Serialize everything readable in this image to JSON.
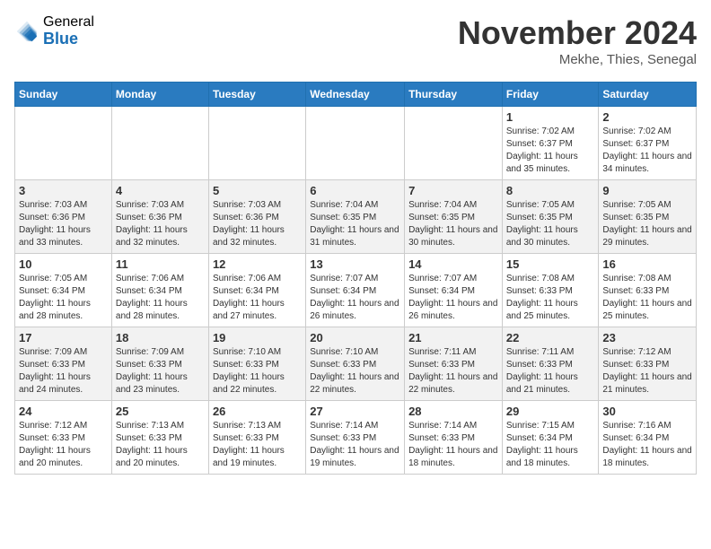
{
  "header": {
    "logo_general": "General",
    "logo_blue": "Blue",
    "month_title": "November 2024",
    "location": "Mekhe, Thies, Senegal"
  },
  "days_of_week": [
    "Sunday",
    "Monday",
    "Tuesday",
    "Wednesday",
    "Thursday",
    "Friday",
    "Saturday"
  ],
  "weeks": [
    [
      {
        "day": "",
        "info": ""
      },
      {
        "day": "",
        "info": ""
      },
      {
        "day": "",
        "info": ""
      },
      {
        "day": "",
        "info": ""
      },
      {
        "day": "",
        "info": ""
      },
      {
        "day": "1",
        "info": "Sunrise: 7:02 AM\nSunset: 6:37 PM\nDaylight: 11 hours and 35 minutes."
      },
      {
        "day": "2",
        "info": "Sunrise: 7:02 AM\nSunset: 6:37 PM\nDaylight: 11 hours and 34 minutes."
      }
    ],
    [
      {
        "day": "3",
        "info": "Sunrise: 7:03 AM\nSunset: 6:36 PM\nDaylight: 11 hours and 33 minutes."
      },
      {
        "day": "4",
        "info": "Sunrise: 7:03 AM\nSunset: 6:36 PM\nDaylight: 11 hours and 32 minutes."
      },
      {
        "day": "5",
        "info": "Sunrise: 7:03 AM\nSunset: 6:36 PM\nDaylight: 11 hours and 32 minutes."
      },
      {
        "day": "6",
        "info": "Sunrise: 7:04 AM\nSunset: 6:35 PM\nDaylight: 11 hours and 31 minutes."
      },
      {
        "day": "7",
        "info": "Sunrise: 7:04 AM\nSunset: 6:35 PM\nDaylight: 11 hours and 30 minutes."
      },
      {
        "day": "8",
        "info": "Sunrise: 7:05 AM\nSunset: 6:35 PM\nDaylight: 11 hours and 30 minutes."
      },
      {
        "day": "9",
        "info": "Sunrise: 7:05 AM\nSunset: 6:35 PM\nDaylight: 11 hours and 29 minutes."
      }
    ],
    [
      {
        "day": "10",
        "info": "Sunrise: 7:05 AM\nSunset: 6:34 PM\nDaylight: 11 hours and 28 minutes."
      },
      {
        "day": "11",
        "info": "Sunrise: 7:06 AM\nSunset: 6:34 PM\nDaylight: 11 hours and 28 minutes."
      },
      {
        "day": "12",
        "info": "Sunrise: 7:06 AM\nSunset: 6:34 PM\nDaylight: 11 hours and 27 minutes."
      },
      {
        "day": "13",
        "info": "Sunrise: 7:07 AM\nSunset: 6:34 PM\nDaylight: 11 hours and 26 minutes."
      },
      {
        "day": "14",
        "info": "Sunrise: 7:07 AM\nSunset: 6:34 PM\nDaylight: 11 hours and 26 minutes."
      },
      {
        "day": "15",
        "info": "Sunrise: 7:08 AM\nSunset: 6:33 PM\nDaylight: 11 hours and 25 minutes."
      },
      {
        "day": "16",
        "info": "Sunrise: 7:08 AM\nSunset: 6:33 PM\nDaylight: 11 hours and 25 minutes."
      }
    ],
    [
      {
        "day": "17",
        "info": "Sunrise: 7:09 AM\nSunset: 6:33 PM\nDaylight: 11 hours and 24 minutes."
      },
      {
        "day": "18",
        "info": "Sunrise: 7:09 AM\nSunset: 6:33 PM\nDaylight: 11 hours and 23 minutes."
      },
      {
        "day": "19",
        "info": "Sunrise: 7:10 AM\nSunset: 6:33 PM\nDaylight: 11 hours and 22 minutes."
      },
      {
        "day": "20",
        "info": "Sunrise: 7:10 AM\nSunset: 6:33 PM\nDaylight: 11 hours and 22 minutes."
      },
      {
        "day": "21",
        "info": "Sunrise: 7:11 AM\nSunset: 6:33 PM\nDaylight: 11 hours and 22 minutes."
      },
      {
        "day": "22",
        "info": "Sunrise: 7:11 AM\nSunset: 6:33 PM\nDaylight: 11 hours and 21 minutes."
      },
      {
        "day": "23",
        "info": "Sunrise: 7:12 AM\nSunset: 6:33 PM\nDaylight: 11 hours and 21 minutes."
      }
    ],
    [
      {
        "day": "24",
        "info": "Sunrise: 7:12 AM\nSunset: 6:33 PM\nDaylight: 11 hours and 20 minutes."
      },
      {
        "day": "25",
        "info": "Sunrise: 7:13 AM\nSunset: 6:33 PM\nDaylight: 11 hours and 20 minutes."
      },
      {
        "day": "26",
        "info": "Sunrise: 7:13 AM\nSunset: 6:33 PM\nDaylight: 11 hours and 19 minutes."
      },
      {
        "day": "27",
        "info": "Sunrise: 7:14 AM\nSunset: 6:33 PM\nDaylight: 11 hours and 19 minutes."
      },
      {
        "day": "28",
        "info": "Sunrise: 7:14 AM\nSunset: 6:33 PM\nDaylight: 11 hours and 18 minutes."
      },
      {
        "day": "29",
        "info": "Sunrise: 7:15 AM\nSunset: 6:34 PM\nDaylight: 11 hours and 18 minutes."
      },
      {
        "day": "30",
        "info": "Sunrise: 7:16 AM\nSunset: 6:34 PM\nDaylight: 11 hours and 18 minutes."
      }
    ]
  ]
}
